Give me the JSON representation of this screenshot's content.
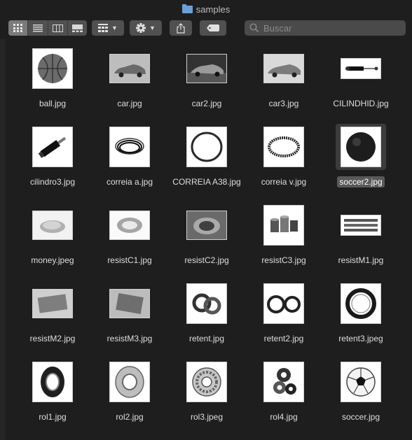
{
  "window": {
    "title": "samples"
  },
  "toolbar": {
    "views": [
      "icon-view",
      "list-view",
      "column-view",
      "gallery-view"
    ],
    "active_view": 0,
    "search_placeholder": "Buscar"
  },
  "files": [
    {
      "name": "ball.jpg",
      "thumb": "basketball"
    },
    {
      "name": "car.jpg",
      "thumb": "car"
    },
    {
      "name": "car2.jpg",
      "thumb": "car-dark"
    },
    {
      "name": "car3.jpg",
      "thumb": "car-red"
    },
    {
      "name": "CILINDHID.jpg",
      "thumb": "cylinder-thin"
    },
    {
      "name": "cilindro3.jpg",
      "thumb": "cylinder-diag"
    },
    {
      "name": "correia a.jpg",
      "thumb": "belt-a"
    },
    {
      "name": "CORREIA A38.jpg",
      "thumb": "belt-ring"
    },
    {
      "name": "correia v.jpg",
      "thumb": "belt-v"
    },
    {
      "name": "soccer2.jpg",
      "thumb": "dark-ball",
      "selected": true
    },
    {
      "name": "money.jpeg",
      "thumb": "money"
    },
    {
      "name": "resistC1.jpg",
      "thumb": "band-heater"
    },
    {
      "name": "resistC2.jpg",
      "thumb": "band-heater-2"
    },
    {
      "name": "resistC3.jpg",
      "thumb": "band-heaters"
    },
    {
      "name": "resistM1.jpg",
      "thumb": "strip-heaters"
    },
    {
      "name": "resistM2.jpg",
      "thumb": "plate-heater"
    },
    {
      "name": "resistM3.jpg",
      "thumb": "plate-heater-2"
    },
    {
      "name": "retent.jpg",
      "thumb": "seal-pair"
    },
    {
      "name": "retent2.jpg",
      "thumb": "seal-two"
    },
    {
      "name": "retent3.jpeg",
      "thumb": "seal-large"
    },
    {
      "name": "rol1.jpg",
      "thumb": "bearing-black"
    },
    {
      "name": "rol2.jpg",
      "thumb": "bearing-steel"
    },
    {
      "name": "rol3.jpeg",
      "thumb": "bearing-open"
    },
    {
      "name": "rol4.jpg",
      "thumb": "bearing-stack"
    },
    {
      "name": "soccer.jpg",
      "thumb": "soccer-ball"
    }
  ]
}
